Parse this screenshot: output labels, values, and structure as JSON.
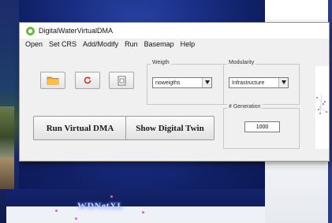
{
  "background": {
    "banner_text": "WDNetXL"
  },
  "window": {
    "title": "DigitalWaterVirtualDMA"
  },
  "menu": [
    "Open",
    "Set CRS",
    "Add/Modify",
    "Run",
    "Basemap",
    "Help"
  ],
  "toolbar": {
    "open_icon": "folder-icon",
    "refresh_icon": "refresh-icon",
    "document_icon": "document-icon"
  },
  "weigth": {
    "label": "Weigth",
    "selected": "noweigths"
  },
  "modularity": {
    "label": "Modularity",
    "selected": "Infrastructure"
  },
  "generation": {
    "label": "# Generation",
    "value": "1000"
  },
  "buttons": {
    "run_virtual_dma": "Run Virtual DMA",
    "show_digital_twin": "Show Digital Twin"
  },
  "colors": {
    "folder": "#f2a81d",
    "refresh": "#c0392b",
    "accent": "#71b93a"
  }
}
